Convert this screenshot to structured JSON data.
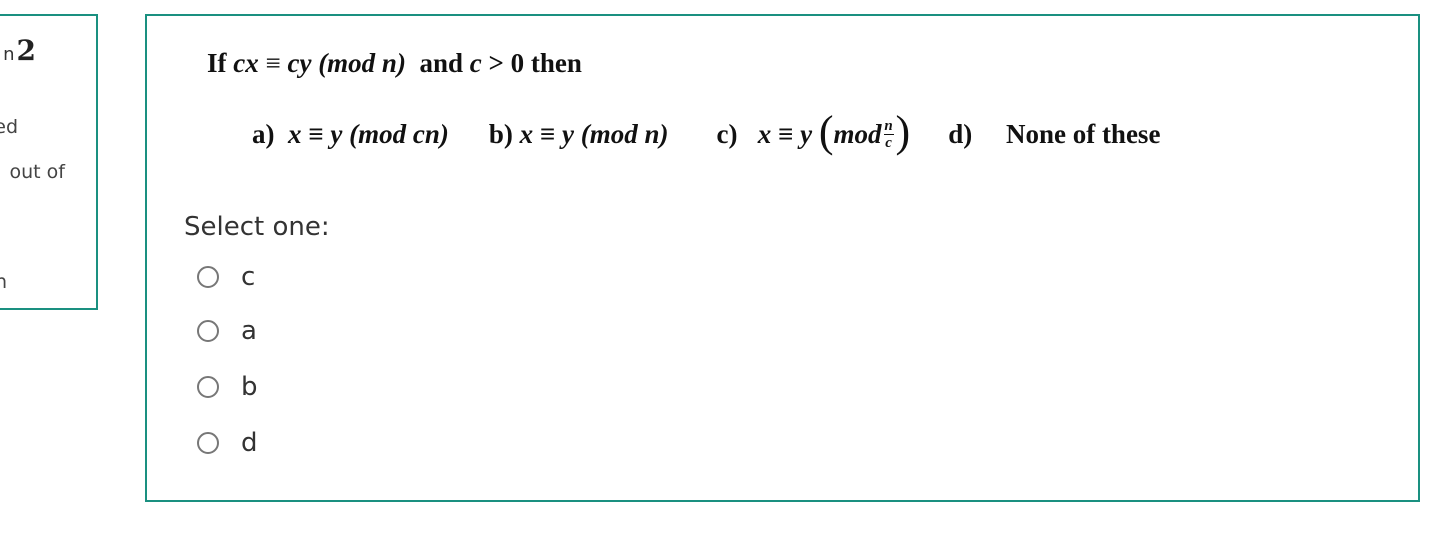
{
  "info_panel": {
    "title_prefix": "n",
    "question_number": "2",
    "line1": "ed",
    "line2": "out of",
    "line3": "n"
  },
  "question": {
    "stem": {
      "if": "If ",
      "lhs": "cx",
      "equiv": " ≡ ",
      "rhs": "cy",
      "mod": " (mod n)",
      "and": "  and ",
      "cond_var": "c",
      "cond": " > 0 then"
    },
    "options": {
      "a_label": "a)",
      "a_expr": "x ≡ y (mod cn)",
      "b_label": "b)",
      "b_expr": "x ≡ y (mod n)",
      "c_label": "c)",
      "c_expr_pre": "x ≡ y ",
      "c_mod": "mod",
      "c_num": "n",
      "c_den": "c",
      "d_label": "d)",
      "d_expr": "None of these"
    },
    "prompt": "Select one:",
    "answers": [
      {
        "label": "c",
        "checked": false
      },
      {
        "label": "a",
        "checked": false
      },
      {
        "label": "b",
        "checked": false
      },
      {
        "label": "d",
        "checked": false
      }
    ]
  },
  "colors": {
    "border": "#1a9080"
  }
}
